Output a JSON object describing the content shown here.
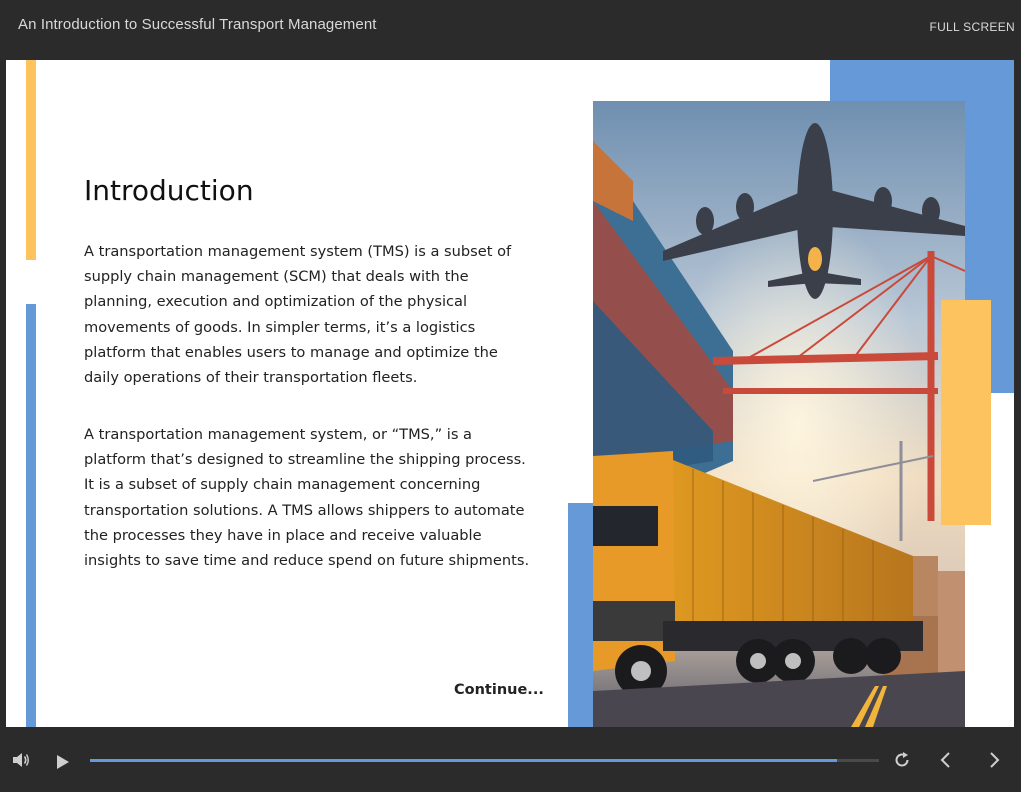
{
  "header": {
    "title": "An Introduction to Successful Transport Management",
    "fullscreen_label": "FULL SCREEN"
  },
  "slide": {
    "heading": "Introduction",
    "paragraphs": [
      "A transportation management system (TMS) is a subset of supply chain management (SCM) that deals with the planning, execution and optimization of the physical movements of goods. In simpler terms, it’s a logistics platform that enables users to manage and optimize the daily operations of their transportation fleets.",
      "A transportation management system, or “TMS,” is a platform that’s designed to streamline the shipping process. It is a subset of supply chain management concerning transportation solutions. A TMS allows shippers to automate the processes they have in place and receive valuable insights to save time and reduce spend on future shipments."
    ],
    "continue_label": "Continue...",
    "image_icon": "cargo-plane-truck-containers-photo"
  },
  "player": {
    "progress_fraction": 0.947,
    "icons": {
      "volume": "volume-icon",
      "play": "play-icon",
      "replay": "replay-icon",
      "prev": "chevron-left-icon",
      "next": "chevron-right-icon"
    }
  },
  "colors": {
    "accent_blue": "#6699d8",
    "accent_yellow": "#fdc35e",
    "chrome": "#2b2b2b"
  }
}
